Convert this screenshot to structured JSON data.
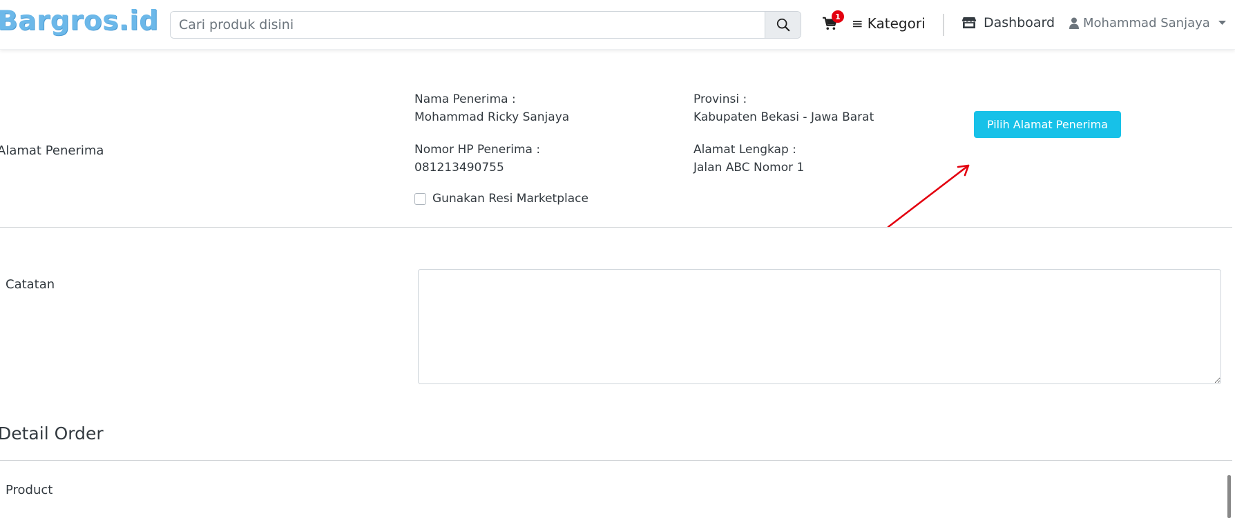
{
  "header": {
    "logo": "Bargros.id",
    "search_placeholder": "Cari produk disini",
    "cart_count": "1",
    "kategori_label": "Kategori",
    "dashboard_label": "Dashboard",
    "user_name": "Mohammad Sanjaya"
  },
  "recipient": {
    "section_label": "Alamat Penerima",
    "name_label": "Nama Penerima :",
    "name_value": "Mohammad Ricky Sanjaya",
    "phone_label": "Nomor HP Penerima :",
    "phone_value": "081213490755",
    "province_label": "Provinsi :",
    "province_value": "Kabupaten Bekasi - Jawa Barat",
    "address_label": "Alamat Lengkap :",
    "address_value": "Jalan ABC Nomor 1",
    "marketplace_checkbox_label": "Gunakan Resi Marketplace",
    "marketplace_checked": false,
    "pick_button_label": "Pilih Alamat Penerima"
  },
  "notes": {
    "label": "Catatan",
    "value": ""
  },
  "order": {
    "title": "Detail Order",
    "product_label": "Product"
  },
  "colors": {
    "accent": "#17c1e8",
    "logo": "#6cb8e9",
    "badge": "#e3000f",
    "annotation_arrow": "#e3000f"
  }
}
